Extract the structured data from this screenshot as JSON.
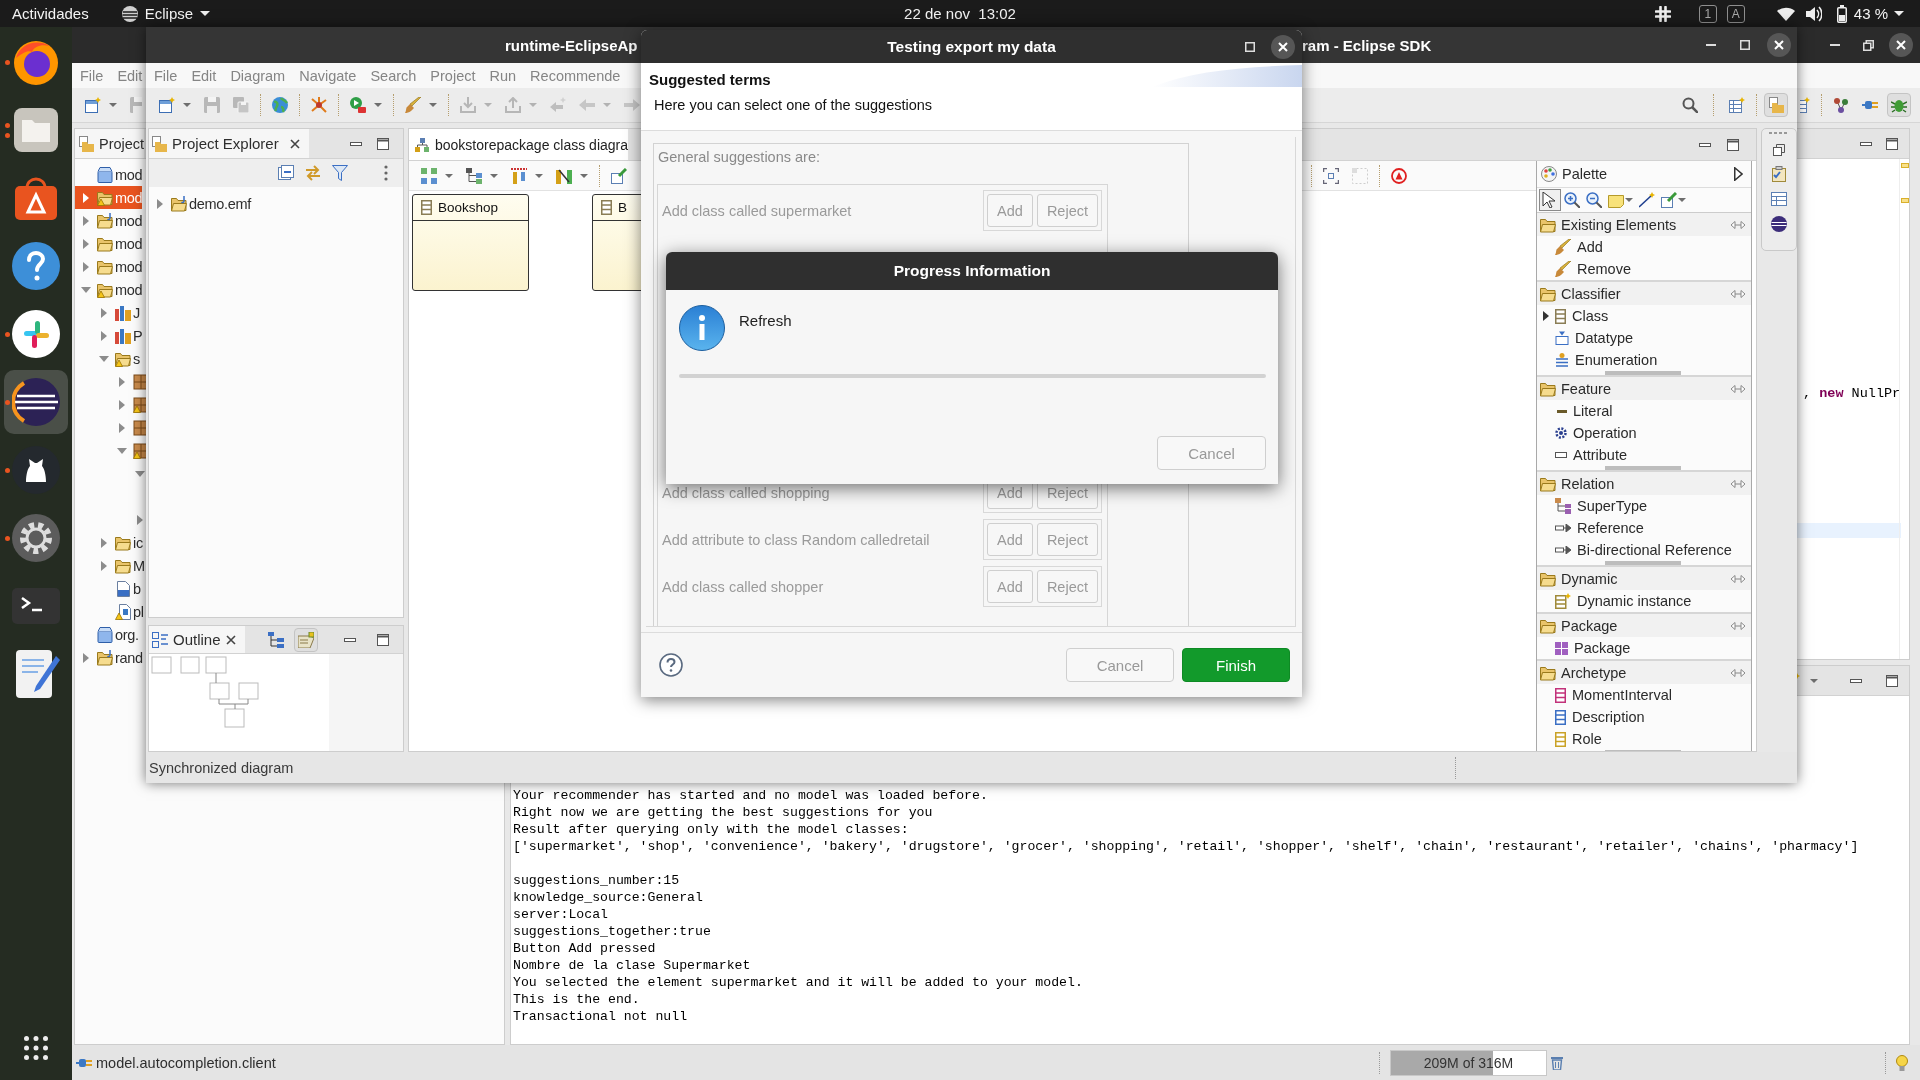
{
  "topbar": {
    "activities": "Actividades",
    "app_menu": "Eclipse",
    "clock": "22 de nov  13:02",
    "indicators": [
      "1",
      "A"
    ],
    "battery": "43 %"
  },
  "dock": {
    "apps": [
      {
        "kind": "browser",
        "running": true,
        "multiple_windows": false,
        "selected": false
      },
      {
        "kind": "files",
        "running": true,
        "multiple_windows": true,
        "selected": false
      },
      {
        "kind": "software",
        "running": false,
        "multiple_windows": false,
        "selected": false
      },
      {
        "kind": "help",
        "running": false,
        "multiple_windows": false,
        "selected": false
      },
      {
        "kind": "chat",
        "running": true,
        "multiple_windows": false,
        "selected": false
      },
      {
        "kind": "ide",
        "running": true,
        "multiple_windows": false,
        "selected": true
      },
      {
        "kind": "git",
        "running": true,
        "multiple_windows": false,
        "selected": false
      },
      {
        "kind": "settings",
        "running": true,
        "multiple_windows": false,
        "selected": false
      },
      {
        "kind": "terminal",
        "running": false,
        "multiple_windows": false,
        "selected": false
      },
      {
        "kind": "editor",
        "running": false,
        "multiple_windows": false,
        "selected": false
      }
    ]
  },
  "back_window": {
    "menu": [
      "File",
      "Edit"
    ],
    "toolbar": [
      {
        "kind": "new",
        "dropdown": true,
        "disabled": false
      },
      {
        "kind": "save",
        "dropdown": false,
        "disabled": true
      }
    ],
    "perspectives": [
      {
        "kind": "new-table",
        "selected": false
      },
      {
        "kind": "git",
        "selected": false
      },
      {
        "kind": "plugin",
        "selected": false
      },
      {
        "kind": "debug",
        "selected": true
      }
    ],
    "project_panel": {
      "tab": "Project",
      "tree": [
        {
          "label": "mod",
          "kind": "closed-project",
          "selected": false
        },
        {
          "label": "mod",
          "kind": "project-warning",
          "selected": true,
          "expanded": false
        },
        {
          "label": "mod",
          "kind": "java-project",
          "selected": false,
          "expanded": false
        },
        {
          "label": "mod",
          "kind": "project",
          "selected": false,
          "expanded": false
        },
        {
          "label": "mod",
          "kind": "project",
          "selected": false,
          "expanded": false
        },
        {
          "label": "mod",
          "kind": "project-warning",
          "selected": false,
          "expanded": true,
          "children": [
            {
              "label": "J",
              "kind": "library",
              "selected": false,
              "expanded": false
            },
            {
              "label": "P",
              "kind": "library",
              "selected": false,
              "expanded": false
            },
            {
              "label": "s",
              "kind": "source-folder",
              "selected": false,
              "expanded": true,
              "children": [
                {
                  "kind": "package",
                  "selected": false,
                  "expanded": false
                },
                {
                  "kind": "package-warning",
                  "selected": false,
                  "expanded": false
                },
                {
                  "kind": "package",
                  "selected": false,
                  "expanded": false
                },
                {
                  "kind": "package-warning",
                  "selected": false,
                  "expanded": true,
                  "children": [
                    {
                      "selected": false,
                      "expanded": true
                    },
                    {
                      "selected": false,
                      "expanded": false
                    }
                  ]
                }
              ]
            },
            {
              "label": "ic",
              "kind": "folder",
              "selected": false,
              "expanded": false
            },
            {
              "label": "M",
              "kind": "folder",
              "selected": false,
              "expanded": false
            },
            {
              "label": "b",
              "kind": "binary-file",
              "selected": false
            },
            {
              "label": "pl",
              "kind": "plugin-file",
              "selected": false
            }
          ]
        },
        {
          "label": "org.",
          "kind": "closed-project",
          "selected": false
        },
        {
          "label": "rand",
          "kind": "java-project",
          "selected": false,
          "expanded": false
        }
      ]
    },
    "editor": {
      "code": ", **new** NullPr"
    },
    "console": {
      "blocks": [
        [
          "Your recommender has started and no model was loaded before.",
          "Right now we are getting the best suggestions for you",
          "Result after querying only with the model classes:",
          "['supermarket', 'shop', 'convenience', 'bakery', 'drugstore', 'grocer', 'shopping', 'retail', 'shopper', 'shelf', 'chain', 'restaurant', 'retailer', 'chains', 'pharmacy']"
        ],
        [
          "suggestions_number:15",
          "knowledge_source:General",
          "server:Local",
          "suggestions_together:true",
          "Button Add pressed",
          "Nombre de la clase Supermarket",
          "You selected the element supermarket and it will be added to your model.",
          "This is the end.",
          "Transactional not null"
        ]
      ]
    },
    "status": {
      "text": "model.autocompletion.client",
      "memory": {
        "reading": "209M of 316M",
        "level": 0.66
      }
    }
  },
  "eclipse_window": {
    "title_start": "runtime-EclipseAp",
    "title_end": "ram - Eclipse SDK",
    "menu": [
      "File",
      "Edit",
      "Diagram",
      "Navigate",
      "Search",
      "Project",
      "Run",
      "Recommende"
    ],
    "toolbar_groups": [
      [
        {
          "kind": "new",
          "dropdown": true,
          "disabled": false
        },
        {
          "kind": "save",
          "dropdown": false,
          "disabled": true
        },
        {
          "kind": "save-all",
          "dropdown": false,
          "disabled": true
        }
      ],
      [
        {
          "kind": "globe",
          "dropdown": false,
          "disabled": false
        }
      ],
      [
        {
          "kind": "burst",
          "dropdown": false,
          "disabled": false
        }
      ],
      [
        {
          "kind": "run",
          "dropdown": true,
          "disabled": false
        }
      ],
      [
        {
          "kind": "brush",
          "dropdown": true,
          "disabled": false
        }
      ],
      [
        {
          "kind": "import",
          "dropdown": true,
          "disabled": true
        },
        {
          "kind": "export",
          "dropdown": true,
          "disabled": true
        },
        {
          "kind": "back-edit",
          "dropdown": false,
          "disabled": true
        },
        {
          "kind": "back",
          "dropdown": true,
          "disabled": true
        },
        {
          "kind": "forward",
          "dropdown": false,
          "disabled": true
        }
      ]
    ],
    "perspectives": [
      {
        "kind": "new-table",
        "selected": false
      },
      {
        "kind": "resource",
        "selected": true
      }
    ],
    "project_explorer": {
      "tab": "Project Explorer",
      "tree": [
        {
          "label": "demo.emf",
          "kind": "model-project",
          "selected": false,
          "expanded": false
        }
      ]
    },
    "outline": {
      "tab": "Outline",
      "views": [
        {
          "kind": "tree",
          "selected": false
        },
        {
          "kind": "thumbnail",
          "selected": true
        }
      ]
    },
    "editor": {
      "tab": "bookstorepackage class diagra",
      "toolbar_groups": [
        [
          {
            "kind": "arrange",
            "dropdown": true,
            "disabled": false
          },
          {
            "kind": "layout",
            "dropdown": true,
            "disabled": false
          },
          {
            "kind": "align",
            "dropdown": true,
            "disabled": false
          },
          {
            "kind": "route",
            "dropdown": true,
            "disabled": false
          }
        ],
        [
          {
            "kind": "pin",
            "dropdown": false,
            "disabled": false
          }
        ]
      ],
      "toolbar_right_groups": [
        [
          {
            "kind": "fit",
            "dropdown": false,
            "disabled": false
          },
          {
            "kind": "fit-selection",
            "dropdown": false,
            "disabled": true
          }
        ],
        [
          {
            "kind": "validate",
            "dropdown": false,
            "disabled": false
          }
        ]
      ],
      "classes": [
        {
          "name": "Bookshop"
        },
        {
          "name": "B"
        }
      ]
    },
    "palette": {
      "title": "Palette",
      "tools": [
        {
          "kind": "select",
          "selected": true,
          "dropdown": false
        },
        {
          "kind": "zoom-in",
          "selected": false,
          "dropdown": false
        },
        {
          "kind": "zoom-out",
          "selected": false,
          "dropdown": false
        },
        {
          "kind": "note",
          "selected": false,
          "dropdown": true
        },
        {
          "kind": "connection",
          "selected": false,
          "dropdown": false
        },
        {
          "kind": "note-attachment",
          "selected": false,
          "dropdown": true
        }
      ],
      "drawers": [
        {
          "label": "Existing Elements",
          "expanded": true,
          "scrollable": false,
          "items": [
            {
              "label": "Add",
              "kind": "tool"
            },
            {
              "label": "Remove",
              "kind": "tool"
            }
          ]
        },
        {
          "label": "Classifier",
          "expanded": true,
          "scrollable": true,
          "items": [
            {
              "label": "Class",
              "kind": "class-stack"
            },
            {
              "label": "Datatype",
              "kind": "datatype"
            },
            {
              "label": "Enumeration",
              "kind": "enumeration"
            }
          ]
        },
        {
          "label": "Feature",
          "expanded": true,
          "scrollable": true,
          "items": [
            {
              "label": "Literal",
              "kind": "literal"
            },
            {
              "label": "Operation",
              "kind": "operation"
            },
            {
              "label": "Attribute",
              "kind": "attribute"
            }
          ]
        },
        {
          "label": "Relation",
          "expanded": true,
          "scrollable": true,
          "items": [
            {
              "label": "SuperType",
              "kind": "supertype"
            },
            {
              "label": "Reference",
              "kind": "reference"
            },
            {
              "label": "Bi-directional Reference",
              "kind": "reference"
            }
          ]
        },
        {
          "label": "Dynamic",
          "expanded": true,
          "scrollable": false,
          "items": [
            {
              "label": "Dynamic instance",
              "kind": "instance"
            }
          ]
        },
        {
          "label": "Package",
          "expanded": true,
          "scrollable": false,
          "items": [
            {
              "label": "Package",
              "kind": "package"
            }
          ]
        },
        {
          "label": "Archetype",
          "expanded": true,
          "scrollable": true,
          "items": [
            {
              "label": "MomentInterval",
              "kind": "archetype",
              "color": "#c2327a"
            },
            {
              "label": "Description",
              "kind": "archetype",
              "color": "#3b6fc4"
            },
            {
              "label": "Role",
              "kind": "archetype",
              "color": "#c9a227"
            }
          ]
        }
      ]
    },
    "status": "Synchronized diagram"
  },
  "wizard_dialog": {
    "title": "Testing export my data",
    "heading": "Suggested terms",
    "description": "Here you can select one of the suggestions",
    "group_label": "General suggestions are:",
    "suggestions_above": [
      {
        "text": "Add class called supermarket",
        "disabled": true,
        "actions": [
          "Add",
          "Reject"
        ]
      }
    ],
    "suggestions_below": [
      {
        "text": "Add class called shopping",
        "disabled": true,
        "actions": [
          "Add",
          "Reject"
        ]
      },
      {
        "text": "Add attribute to class Random calledretail",
        "disabled": true,
        "actions": [
          "Add",
          "Reject"
        ]
      },
      {
        "text": "Add class called shopper",
        "disabled": true,
        "actions": [
          "Add",
          "Reject"
        ]
      }
    ],
    "buttons": [
      {
        "label": "Cancel",
        "kind": "secondary",
        "disabled": true
      },
      {
        "label": "Finish",
        "kind": "primary",
        "disabled": false
      }
    ]
  },
  "progress_dialog": {
    "title": "Progress Information",
    "message": "Refresh",
    "level": 0,
    "button": {
      "label": "Cancel",
      "disabled": true
    }
  }
}
